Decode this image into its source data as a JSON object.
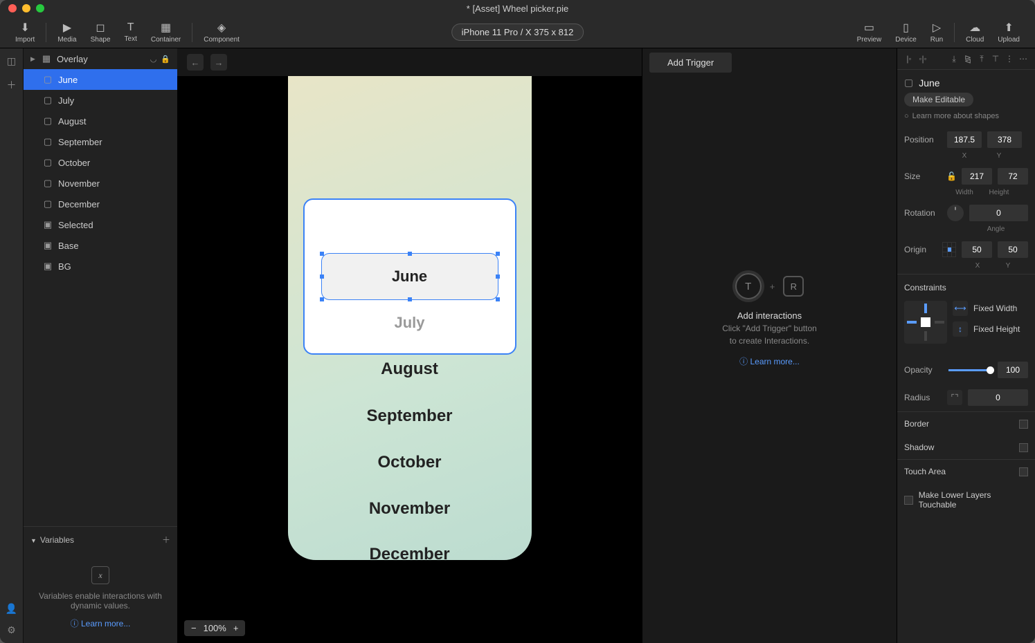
{
  "titlebar": {
    "title": "* [Asset] Wheel picker.pie"
  },
  "toolbar": {
    "import": "Import",
    "media": "Media",
    "shape": "Shape",
    "text": "Text",
    "container": "Container",
    "component": "Component",
    "device_chip": "iPhone 11 Pro / X  375 x 812",
    "preview": "Preview",
    "device": "Device",
    "run": "Run",
    "cloud": "Cloud",
    "upload": "Upload"
  },
  "layers": {
    "items": [
      {
        "name": "Overlay",
        "expandable": true,
        "trail_eye": true,
        "trail_lock": true
      },
      {
        "name": "June",
        "indent": true,
        "selected": true
      },
      {
        "name": "July",
        "indent": true
      },
      {
        "name": "August",
        "indent": true
      },
      {
        "name": "September",
        "indent": true
      },
      {
        "name": "October",
        "indent": true
      },
      {
        "name": "November",
        "indent": true
      },
      {
        "name": "December",
        "indent": true
      },
      {
        "name": "Selected",
        "indent": true
      },
      {
        "name": "Base",
        "indent": true
      },
      {
        "name": "BG",
        "indent": true
      }
    ]
  },
  "variables": {
    "header": "Variables",
    "placeholder": "Variables enable interactions with dynamic values.",
    "learn_more": "Learn more..."
  },
  "canvas": {
    "months": [
      "June",
      "July",
      "August",
      "September",
      "October",
      "November",
      "December"
    ],
    "zoom": "100%"
  },
  "interactions": {
    "add_trigger": "Add Trigger",
    "title": "Add interactions",
    "sub1": "Click \"Add Trigger\" button",
    "sub2": "to create Interactions.",
    "learn_more": "Learn more..."
  },
  "inspector": {
    "header": "June",
    "make_editable": "Make Editable",
    "learn_shapes": "Learn more about shapes",
    "position": {
      "label": "Position",
      "x": "187.5",
      "y": "378",
      "xl": "X",
      "yl": "Y"
    },
    "size": {
      "label": "Size",
      "w": "217",
      "h": "72",
      "wl": "Width",
      "hl": "Height"
    },
    "rotation": {
      "label": "Rotation",
      "angle": "0",
      "al": "Angle"
    },
    "origin": {
      "label": "Origin",
      "x": "50",
      "y": "50",
      "xl": "X",
      "yl": "Y"
    },
    "constraints": {
      "label": "Constraints",
      "fixed_width": "Fixed Width",
      "fixed_height": "Fixed Height"
    },
    "opacity": {
      "label": "Opacity",
      "value": "100"
    },
    "radius": {
      "label": "Radius",
      "value": "0"
    },
    "border": "Border",
    "shadow": "Shadow",
    "touch_area": "Touch Area",
    "make_lower": "Make Lower Layers Touchable"
  }
}
